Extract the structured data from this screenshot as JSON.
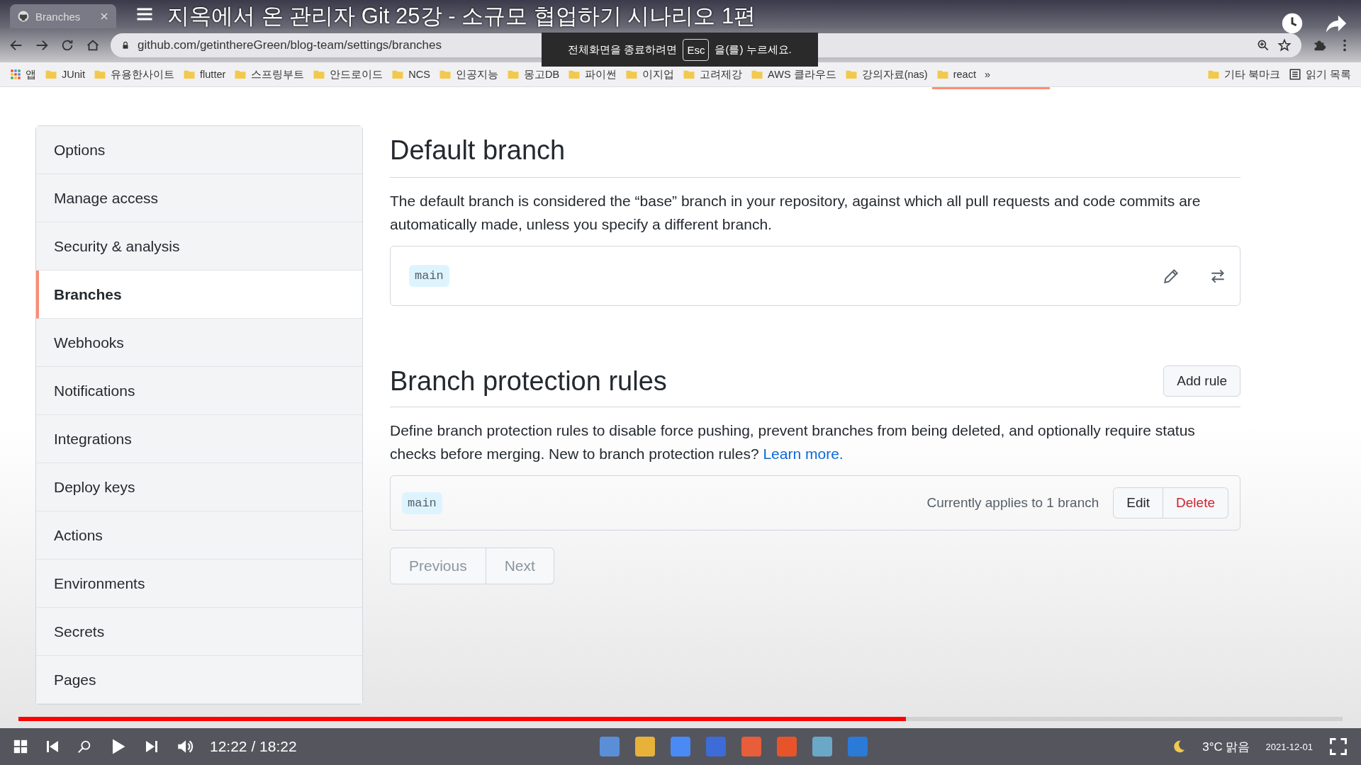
{
  "video": {
    "title": "지옥에서 온 관리자 Git 25강 - 소규모 협업하기 시나리오 1편",
    "time": "12:22 / 18:22",
    "level": 0.67
  },
  "browser": {
    "tab_title": "Branches",
    "url": "github.com/getinthereGreen/blog-team/settings/branches",
    "apps": "앱",
    "bookmarks": [
      "JUnit",
      "유용한사이트",
      "flutter",
      "스프링부트",
      "안드로이드",
      "NCS",
      "인공지능",
      "몽고DB",
      "파이썬",
      "이지업",
      "고려제강",
      "AWS 클라우드",
      "강의자료(nas)",
      "react"
    ],
    "more": "»",
    "other_bookmarks": "기타 북마크",
    "reading_list": "읽기 목록"
  },
  "fullscreen_notice": {
    "before": "전체화면을 종료하려면",
    "key": "Esc",
    "after": "을(를) 누르세요."
  },
  "sidebar": {
    "items": [
      {
        "label": "Options",
        "selected": false
      },
      {
        "label": "Manage access",
        "selected": false
      },
      {
        "label": "Security & analysis",
        "selected": false
      },
      {
        "label": "Branches",
        "selected": true
      },
      {
        "label": "Webhooks",
        "selected": false
      },
      {
        "label": "Notifications",
        "selected": false
      },
      {
        "label": "Integrations",
        "selected": false
      },
      {
        "label": "Deploy keys",
        "selected": false
      },
      {
        "label": "Actions",
        "selected": false
      },
      {
        "label": "Environments",
        "selected": false
      },
      {
        "label": "Secrets",
        "selected": false
      },
      {
        "label": "Pages",
        "selected": false
      }
    ]
  },
  "default_branch": {
    "heading": "Default branch",
    "description": "The default branch is considered the “base” branch in your repository, against which all pull requests and code commits are automatically made, unless you specify a different branch.",
    "branch": "main"
  },
  "protection": {
    "heading": "Branch protection rules",
    "add_button": "Add rule",
    "description": "Define branch protection rules to disable force pushing, prevent branches from being deleted, and optionally require status checks before merging. New to branch protection rules?",
    "link": "Learn more.",
    "rules": [
      {
        "branch": "main",
        "applies": "Currently applies to 1 branch",
        "edit": "Edit",
        "delete": "Delete"
      }
    ]
  },
  "pagination": [
    {
      "label": "Previous",
      "disabled": true
    },
    {
      "label": "Next",
      "disabled": true
    }
  ],
  "taskbar": {
    "weather": "3°C 맑음",
    "date": "2021-12-01"
  }
}
